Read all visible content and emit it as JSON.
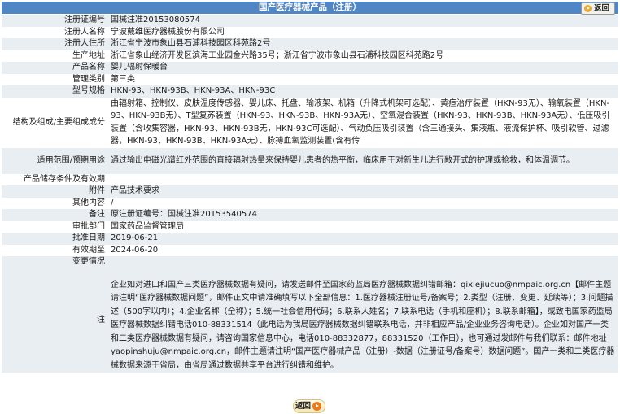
{
  "header": {
    "title": "国产医疗器械产品（注册）",
    "back_label": "返回"
  },
  "rows": [
    {
      "label": "注册证编号",
      "value": "国械注准20153080574"
    },
    {
      "label": "注册人名称",
      "value": "宁波戴维医疗器械股份有限公司"
    },
    {
      "label": "注册人住所",
      "value": "浙江省宁波市象山县石浦科技园区科苑路2号"
    },
    {
      "label": "生产地址",
      "value": "浙江省象山经济开发区滨海工业园金兴路35号；浙江省宁波市象山县石浦科技园区科苑路2号"
    },
    {
      "label": "产品名称",
      "value": "婴儿辐射保暖台"
    },
    {
      "label": "管理类别",
      "value": "第三类"
    },
    {
      "label": "型号规格",
      "value": "HKN-93、HKN-93B、HKN-93A、HKN-93C"
    },
    {
      "label": "结构及组成/主要组成成分",
      "value": "由辐射箱、控制仪、皮肤温度传感器、婴儿床、托盘、输液架、机箱（升降式机架可选配）、黄疸治疗装置（HKN-93无）、输氧装置（HKN-93、HKN-93B无）、T型复苏装置（HKN-93、HKN-93B、HKN-93A无）、空氧混合装置（HKN-93、HKN-93B、HKN-93A无）、低压吸引装置（含收集容器，HKN-93、HKN-93B无，HKN-93C可选配）、气动负压吸引装置（含三通接头、集液瓶、液流保护杯、吸引软管、过滤器，HKN-93、HKN-93B、HKN-93A无）、脉搏血氧监测装置(含有传"
    },
    {
      "label": "适用范围/预期用途",
      "value": "通过输出电磁光谱红外范围的直接辐射热量来保持婴儿患者的热平衡，临床用于对新生儿进行敞开式的护理或抢救，和体温调节。"
    },
    {
      "label": "产品储存条件及有效期",
      "value": ""
    },
    {
      "label": "附件",
      "value": "产品技术要求"
    },
    {
      "label": "其他内容",
      "value": "/"
    },
    {
      "label": "备注",
      "value": "原注册证编号：国械注准20153540574"
    },
    {
      "label": "审批部门",
      "value": "国家药品监督管理局"
    },
    {
      "label": "批准日期",
      "value": "2019-06-21"
    },
    {
      "label": "有效期至",
      "value": "2024-06-20"
    },
    {
      "label": "变更情况",
      "value": ""
    }
  ],
  "notes": {
    "label": "注",
    "text": "企业如对进口和国产三类医疗器械数据有疑问，请发送邮件至国家药监局医疗器械数据纠错邮箱：qixiejiucuo@nmpaic.org.cn【邮件主题请注明“医疗器械数据问题”，邮件正文中请准确填写以下全部信息：1.医疗器械注册证号/备案号；2.类型（注册、变更、延续等）；3.问题描述（500字以内）；4.企业名称（全称）；5.统一社会信用代码；6.联系人姓名；7.联系电话（手机和座机）；8.联系邮箱】，或致电国家药监局医疗器械数据纠错电话010-88331514（此电话为我局医疗器械数据纠错联系电话，并非相应产品/企业业务咨询电话）。企业如对国产一类和二类医疗器械数据有疑问，请咨询国家信息中心，电话010-88332877，88331520（工作日），也可通过发邮件与我们联系：邮件地址yaopinshuju@nmpaic.org.cn，邮件主题请注明“国产医疗器械产品（注册）-数据（注册证号/备案号）数据问题”。国产一类和二类医疗器械数据来源于省局，由省局通过数据共享平台进行纠错和维护。"
  },
  "footer": {
    "back_label": "返回"
  }
}
